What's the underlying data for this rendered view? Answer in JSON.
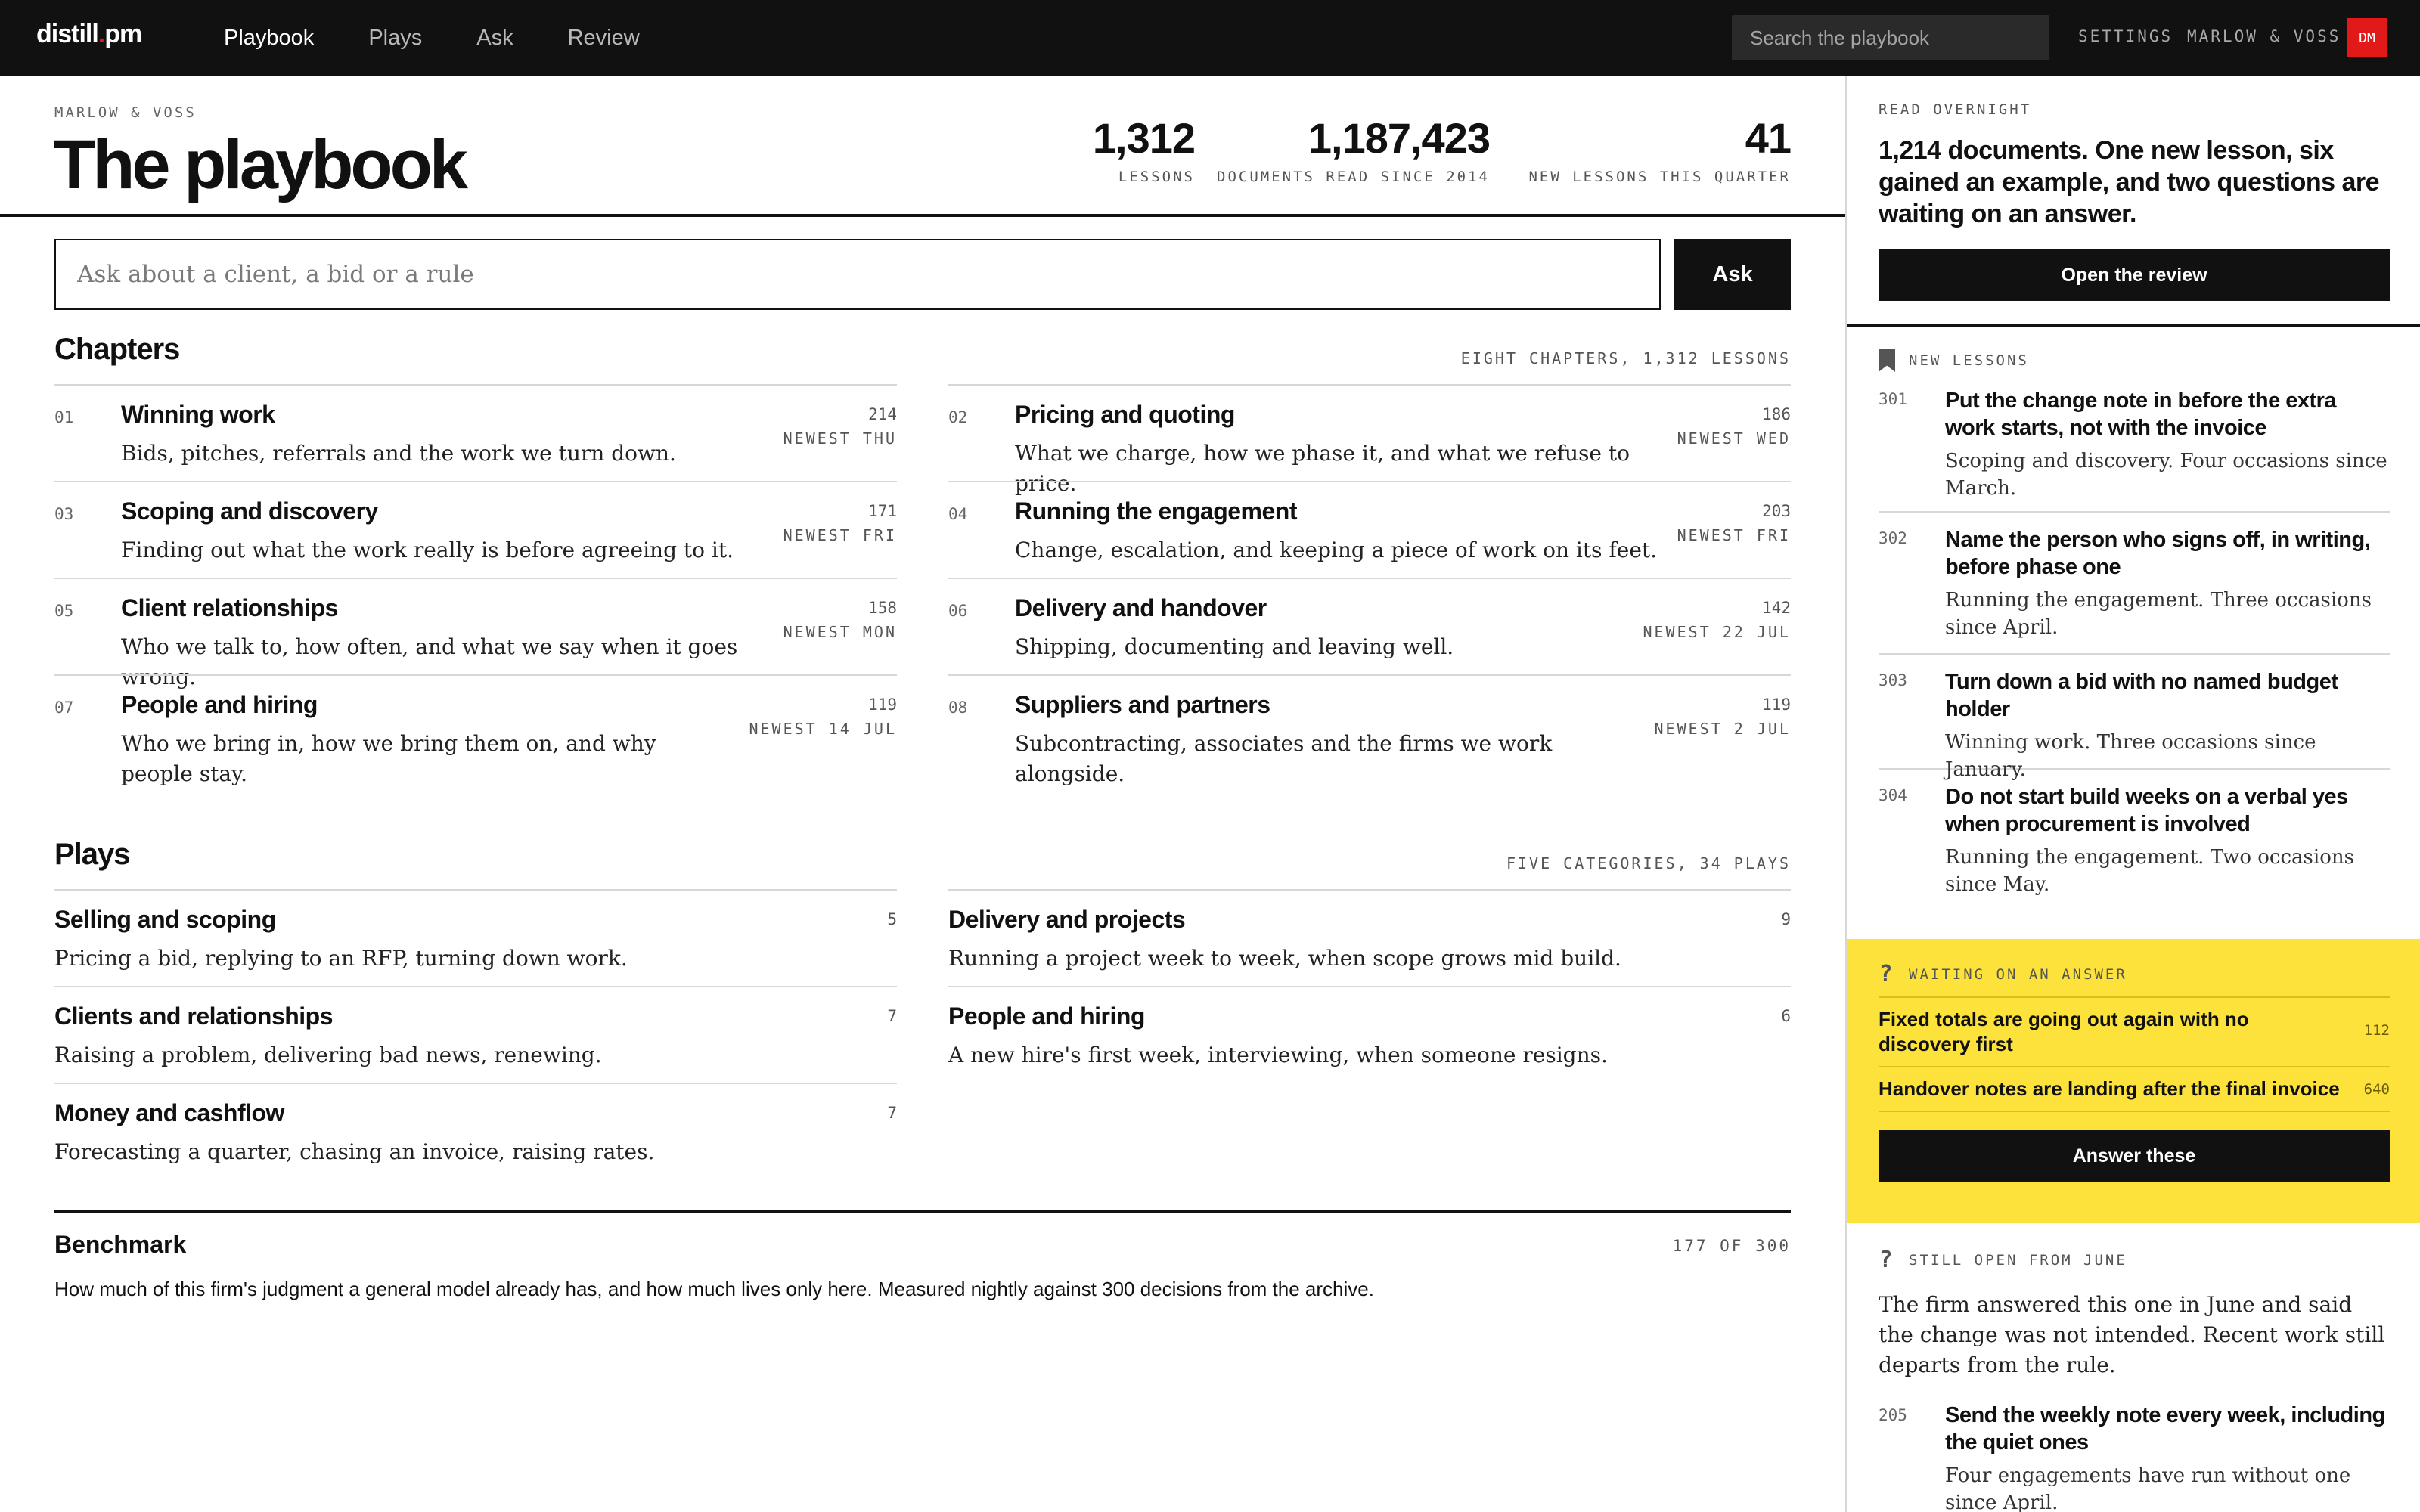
{
  "topbar": {
    "logo_main": "distill",
    "logo_dot": ".",
    "logo_tail": "pm",
    "nav": [
      {
        "label": "Playbook",
        "active": true
      },
      {
        "label": "Plays",
        "active": false
      },
      {
        "label": "Ask",
        "active": false
      },
      {
        "label": "Review",
        "active": false
      }
    ],
    "search_placeholder": "Search the playbook",
    "settings": "SETTINGS",
    "firm": "MARLOW & VOSS",
    "avatar": "DM"
  },
  "header": {
    "kicker": "MARLOW & VOSS",
    "title": "The playbook",
    "stats": [
      {
        "value": "1,312",
        "label": "LESSONS"
      },
      {
        "value": "1,187,423",
        "label": "DOCUMENTS READ SINCE 2014"
      },
      {
        "value": "41",
        "label": "NEW LESSONS THIS QUARTER"
      }
    ]
  },
  "ask": {
    "placeholder": "Ask about a client, a bid or a rule",
    "button": "Ask"
  },
  "chapters": {
    "title": "Chapters",
    "meta": "EIGHT CHAPTERS, 1,312 LESSONS",
    "items": [
      {
        "index": "01",
        "name": "Winning work",
        "desc": "Bids, pitches, referrals and the work we turn down.",
        "count": "214",
        "newest": "NEWEST THU"
      },
      {
        "index": "02",
        "name": "Pricing and quoting",
        "desc": "What we charge, how we phase it, and what we refuse to price.",
        "count": "186",
        "newest": "NEWEST WED"
      },
      {
        "index": "03",
        "name": "Scoping and discovery",
        "desc": "Finding out what the work really is before agreeing to it.",
        "count": "171",
        "newest": "NEWEST FRI"
      },
      {
        "index": "04",
        "name": "Running the engagement",
        "desc": "Change, escalation, and keeping a piece of work on its feet.",
        "count": "203",
        "newest": "NEWEST FRI"
      },
      {
        "index": "05",
        "name": "Client relationships",
        "desc": "Who we talk to, how often, and what we say when it goes wrong.",
        "count": "158",
        "newest": "NEWEST MON"
      },
      {
        "index": "06",
        "name": "Delivery and handover",
        "desc": "Shipping, documenting and leaving well.",
        "count": "142",
        "newest": "NEWEST 22 JUL"
      },
      {
        "index": "07",
        "name": "People and hiring",
        "desc": "Who we bring in, how we bring them on, and why people stay.",
        "count": "119",
        "newest": "NEWEST 14 JUL"
      },
      {
        "index": "08",
        "name": "Suppliers and partners",
        "desc": "Subcontracting, associates and the firms we work alongside.",
        "count": "119",
        "newest": "NEWEST 2 JUL"
      }
    ]
  },
  "plays": {
    "title": "Plays",
    "meta": "FIVE CATEGORIES, 34 PLAYS",
    "items": [
      {
        "name": "Selling and scoping",
        "desc": "Pricing a bid, replying to an RFP, turning down work.",
        "count": "5"
      },
      {
        "name": "Delivery and projects",
        "desc": "Running a project week to week, when scope grows mid build.",
        "count": "9"
      },
      {
        "name": "Clients and relationships",
        "desc": "Raising a problem, delivering bad news, renewing.",
        "count": "7"
      },
      {
        "name": "People and hiring",
        "desc": "A new hire's first week, interviewing, when someone resigns.",
        "count": "6"
      },
      {
        "name": "Money and cashflow",
        "desc": "Forecasting a quarter, chasing an invoice, raising rates.",
        "count": "7"
      }
    ]
  },
  "benchmark": {
    "title": "Benchmark",
    "meta": "177 OF 300",
    "desc": "How much of this firm's judgment a general model already has, and how much lives only here. Measured nightly against 300 decisions from the archive."
  },
  "side": {
    "overnight": {
      "label": "READ OVERNIGHT",
      "text": "1,214 documents. One new lesson, six gained an example, and two questions are waiting on an answer.",
      "button": "Open the review"
    },
    "new_lessons": {
      "label": "NEW LESSONS",
      "icon": "bookmark-icon",
      "items": [
        {
          "num": "301",
          "title": "Put the change note in before the extra work starts, not with the invoice",
          "desc": "Scoping and discovery. Four occasions since March."
        },
        {
          "num": "302",
          "title": "Name the person who signs off, in writing, before phase one",
          "desc": "Running the engagement. Three occasions since April."
        },
        {
          "num": "303",
          "title": "Turn down a bid with no named budget holder",
          "desc": "Winning work. Three occasions since January."
        },
        {
          "num": "304",
          "title": "Do not start build weeks on a verbal yes when procurement is involved",
          "desc": "Running the engagement. Two occasions since May."
        }
      ]
    },
    "waiting": {
      "label": "WAITING ON AN ANSWER",
      "icon": "question-icon",
      "color": "#fce23b",
      "items": [
        {
          "title": "Fixed totals are going out again with no discovery first",
          "num": "112"
        },
        {
          "title": "Handover notes are landing after the final invoice",
          "num": "640"
        }
      ],
      "button": "Answer these"
    },
    "still_open": {
      "label": "STILL OPEN FROM JUNE",
      "icon": "question-icon",
      "text": "The firm answered this one in June and said the change was not intended. Recent work still departs from the rule.",
      "item": {
        "num": "205",
        "title": "Send the weekly note every week, including the quiet ones",
        "desc": "Four engagements have run without one since April."
      }
    }
  },
  "colors": {
    "accent": "#e11919",
    "ink": "#111111",
    "highlight": "#fce23b"
  }
}
